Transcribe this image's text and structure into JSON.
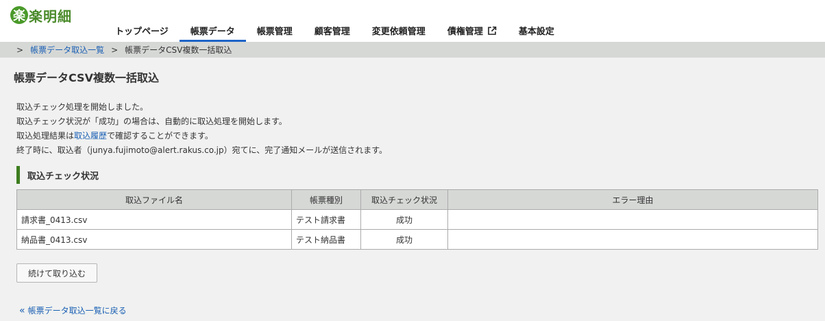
{
  "app": {
    "logo_mark": "楽",
    "logo_text": "楽明細"
  },
  "nav": {
    "items": [
      {
        "label": "トップページ"
      },
      {
        "label": "帳票データ"
      },
      {
        "label": "帳票管理"
      },
      {
        "label": "顧客管理"
      },
      {
        "label": "変更依頼管理"
      },
      {
        "label": "債権管理"
      },
      {
        "label": "基本設定"
      }
    ],
    "active_index": 1
  },
  "breadcrumb": {
    "sep": ">",
    "link": "帳票データ取込一覧",
    "current": "帳票データCSV複数一括取込"
  },
  "page": {
    "title": "帳票データCSV複数一括取込",
    "messages": {
      "line1": "取込チェック処理を開始しました。",
      "line2": "取込チェック状況が「成功」の場合は、自動的に取込処理を開始します。",
      "line3_prefix": "取込処理結果は",
      "line3_link": "取込履歴",
      "line3_suffix": "で確認することができます。",
      "line4": "終了時に、取込者（junya.fujimoto@alert.rakus.co.jp）宛てに、完了通知メールが送信されます。"
    },
    "section_title": "取込チェック状況"
  },
  "table": {
    "headers": [
      "取込ファイル名",
      "帳票種別",
      "取込チェック状況",
      "エラー理由"
    ],
    "rows": [
      [
        "請求書_0413.csv",
        "テスト請求書",
        "成功",
        ""
      ],
      [
        "納品書_0413.csv",
        "テスト納品書",
        "成功",
        ""
      ]
    ]
  },
  "buttons": {
    "continue": "続けて取り込む"
  },
  "back_link": {
    "icon": "«",
    "label": "帳票データ取込一覧に戻る"
  },
  "colors": {
    "accent_blue": "#1d64c8",
    "brand_green": "#4a9a2a",
    "section_bar": "#3d7d1e",
    "link": "#1a5fb4"
  }
}
